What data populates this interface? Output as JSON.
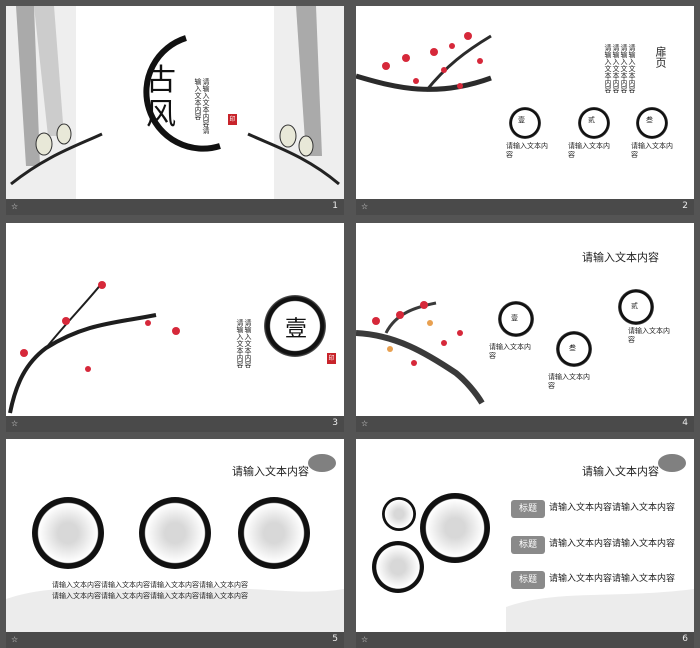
{
  "slides": [
    {
      "number": "1",
      "title": "古风",
      "subtitle": "请输入文本内容请输入文本内容"
    },
    {
      "number": "2",
      "heading": "扉页",
      "paragraph": "请输入文本内容请输入文本内容请输入文本内容请输入文本内容",
      "items": [
        {
          "glyph": "壹",
          "text": "请输入文本内容"
        },
        {
          "glyph": "贰",
          "text": "请输入文本内容"
        },
        {
          "glyph": "叁",
          "text": "请输入文本内容"
        }
      ]
    },
    {
      "number": "3",
      "glyph": "壹",
      "text": "请输入文本内容请输入文本内容"
    },
    {
      "number": "4",
      "heading": "请输入文本内容",
      "items": [
        {
          "glyph": "壹",
          "text": "请输入文本内容"
        },
        {
          "glyph": "贰",
          "text": "请输入文本内容"
        },
        {
          "glyph": "叁",
          "text": "请输入文本内容"
        }
      ]
    },
    {
      "number": "5",
      "heading": "请输入文本内容",
      "line1": "请输入文本内容请输入文本内容请输入文本内容请输入文本内容",
      "line2": "请输入文本内容请输入文本内容请输入文本内容请输入文本内容"
    },
    {
      "number": "6",
      "heading": "请输入文本内容",
      "rows": [
        {
          "label": "标题",
          "text": "请输入文本内容请输入文本内容"
        },
        {
          "label": "标题",
          "text": "请输入文本内容请输入文本内容"
        },
        {
          "label": "标题",
          "text": "请输入文本内容请输入文本内容"
        }
      ]
    }
  ],
  "footer_icon": "☆",
  "colors": {
    "background": "#545454",
    "footer": "#4a4a4a",
    "accent_red": "#c8242b",
    "ink": "#111111"
  }
}
